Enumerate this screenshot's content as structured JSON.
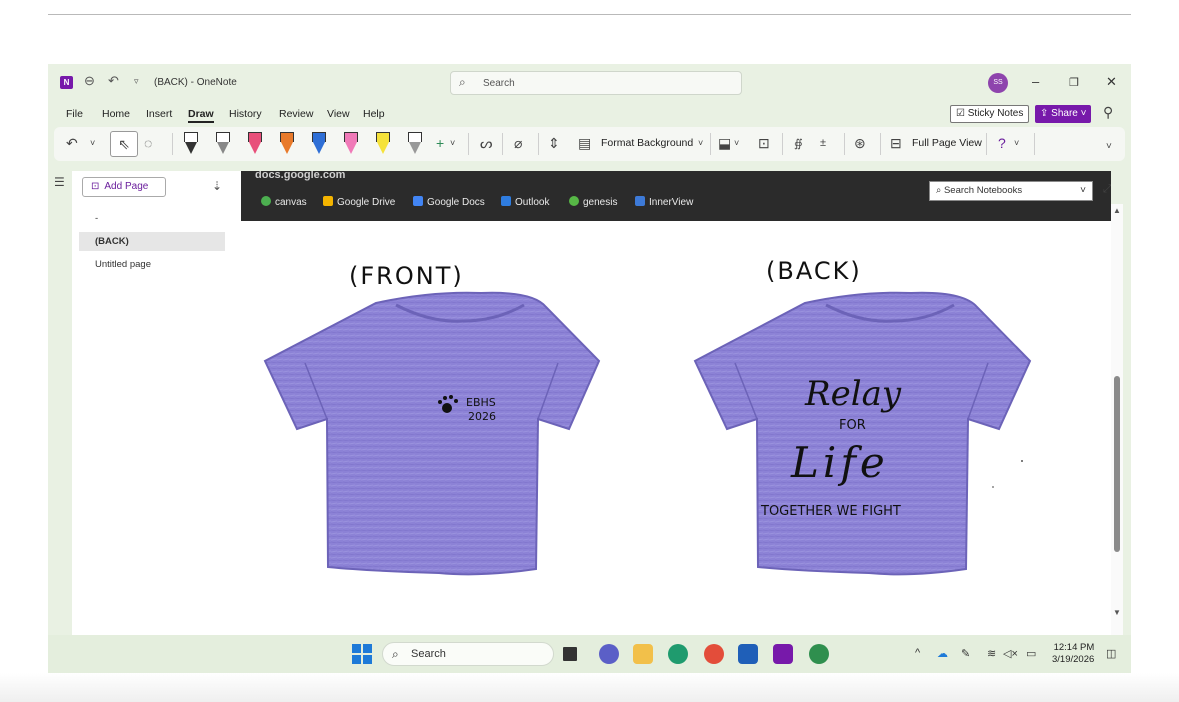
{
  "window": {
    "title": "(BACK) - OneNote",
    "app_icon_letter": "N"
  },
  "titlebar": {
    "search_placeholder": "Search",
    "avatar_initials": "SS",
    "minimize_glyph": "–",
    "restore_glyph": "❐",
    "close_glyph": "✕"
  },
  "menu": {
    "items": [
      "File",
      "Home",
      "Insert",
      "Draw",
      "History",
      "Review",
      "View",
      "Help"
    ],
    "active": "Draw",
    "sticky_notes": "Sticky Notes",
    "share": "Share"
  },
  "ribbon": {
    "format_background": "Format Background",
    "full_page_view": "Full Page View",
    "pen_colors": [
      "#ffffff",
      "#ffffff",
      "#e8507a",
      "#e87a2a",
      "#2f6fd6",
      "#f07ab8",
      "#f5e23a",
      "#ffffff"
    ]
  },
  "pages": {
    "add_page": "Add Page",
    "list": [
      "-",
      "(BACK)",
      "Untitled page"
    ],
    "selected": "(BACK)"
  },
  "browser": {
    "url_fragment": "docs.google.com",
    "bookmarks": [
      {
        "label": "canvas",
        "color": "#4caf50"
      },
      {
        "label": "Google Drive",
        "color": "#f4b400"
      },
      {
        "label": "Google Docs",
        "color": "#4285f4"
      },
      {
        "label": "Outlook",
        "color": "#2f7de0"
      },
      {
        "label": "genesis",
        "color": "#57b846"
      },
      {
        "label": "InnerView",
        "color": "#3d7ad8"
      }
    ]
  },
  "notebook_search": {
    "placeholder": "Search Notebooks"
  },
  "shirts": {
    "front_title": "(FRONT)",
    "back_title": "(BACK)",
    "shirt_color": "#8c82d6",
    "front": {
      "logo_line1": "EBHS",
      "logo_line2": "2026"
    },
    "back": {
      "line1": "Relay",
      "line2": "FOR",
      "line3": "Life",
      "line4": "TOGETHER WE FIGHT"
    }
  },
  "taskbar": {
    "search": "Search",
    "time": "12:14 PM",
    "date": "3/19/2026"
  }
}
